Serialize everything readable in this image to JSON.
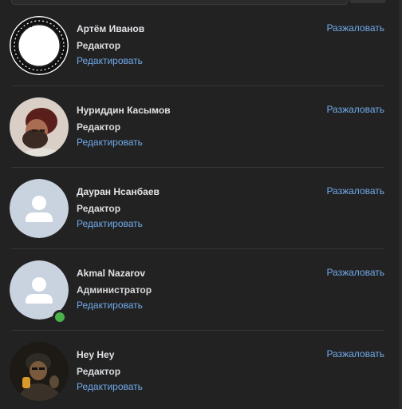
{
  "members": [
    {
      "name": "Артём Иванов",
      "role": "Редактор",
      "edit_label": "Редактировать",
      "demote_label": "Разжаловать",
      "avatar_icon": "ouroboros-avatar",
      "online": false
    },
    {
      "name": "Нуриддин Касымов",
      "role": "Редактор",
      "edit_label": "Редактировать",
      "demote_label": "Разжаловать",
      "avatar_icon": "photo-avatar",
      "online": false
    },
    {
      "name": "Дауран Нсанбаев",
      "role": "Редактор",
      "edit_label": "Редактировать",
      "demote_label": "Разжаловать",
      "avatar_icon": "default-user-avatar",
      "online": false
    },
    {
      "name": "Akmal Nazarov",
      "role": "Администратор",
      "edit_label": "Редактировать",
      "demote_label": "Разжаловать",
      "avatar_icon": "default-user-avatar",
      "online": true
    },
    {
      "name": "Hey Hey",
      "role": "Редактор",
      "edit_label": "Редактировать",
      "demote_label": "Разжаловать",
      "avatar_icon": "photo-avatar",
      "online": false
    }
  ],
  "colors": {
    "background": "#222222",
    "link": "#71aaeb",
    "text": "#e1e3e6",
    "online": "#4bb34b",
    "placeholder_avatar": "#c9d3e0"
  }
}
